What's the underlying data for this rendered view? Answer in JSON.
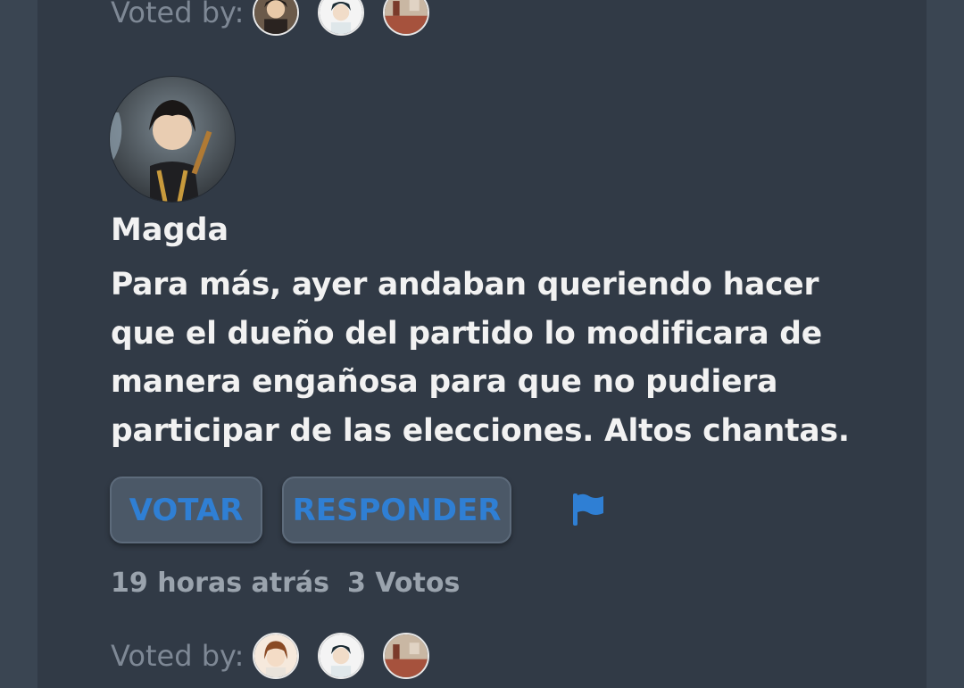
{
  "top_voted": {
    "label": "Voted by:",
    "avatars": [
      "avatar-dark-hair",
      "avatar-anime-boy",
      "avatar-room-scene"
    ]
  },
  "comment": {
    "author": "Magda",
    "avatar_icon": "user-avatar-icon",
    "text": "Para más, ayer andaban queriendo hacer que el dueño del partido lo modificara de manera engañosa para que no pudiera participar de las elecciones. Altos chantas.",
    "vote_button": "VOTAR",
    "reply_button": "RESPONDER",
    "report_icon": "flag-icon",
    "time_ago": "19 horas atrás",
    "votes": "3 Votos",
    "voted_label": "Voted by:",
    "voter_avatars": [
      "avatar-brown-hair-girl",
      "avatar-anime-boy",
      "avatar-room-scene"
    ]
  },
  "colors": {
    "background": "#3a4552",
    "panel": "#313a46",
    "accent": "#2f7fd4",
    "text": "#f2f2f2",
    "muted": "#9aa3ad"
  }
}
